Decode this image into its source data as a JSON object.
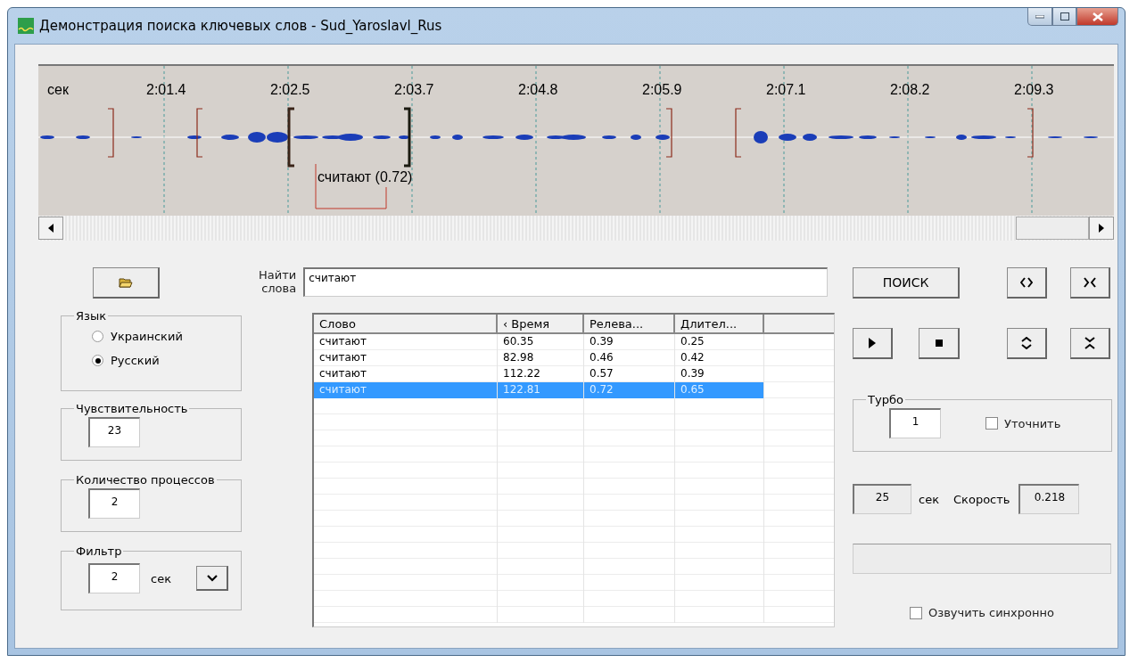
{
  "window": {
    "title": "Демонстрация поиска ключевых слов - Sud_Yaroslavl_Rus"
  },
  "waveform": {
    "unit_label": "сек",
    "time_labels": [
      "2:01.4",
      "2:02.5",
      "2:03.7",
      "2:04.8",
      "2:05.9",
      "2:07.1",
      "2:08.2",
      "2:09.3"
    ],
    "detection_label": "считают (0.72)"
  },
  "search": {
    "label": "Найти слова",
    "value": "считают"
  },
  "language": {
    "title": "Язык",
    "options": [
      {
        "label": "Украинский",
        "selected": false
      },
      {
        "label": "Русский",
        "selected": true
      }
    ]
  },
  "sensitivity": {
    "title": "Чувствительность",
    "value": "23"
  },
  "processes": {
    "title": "Количество процессов",
    "value": "2"
  },
  "filter": {
    "title": "Фильтр",
    "value": "2",
    "unit": "сек"
  },
  "table": {
    "columns": [
      "Слово",
      "‹ Время",
      "Релева...",
      "Длител..."
    ],
    "rows": [
      {
        "cells": [
          "считают",
          "60.35",
          "0.39",
          "0.25"
        ],
        "selected": false
      },
      {
        "cells": [
          "считают",
          "82.98",
          "0.46",
          "0.42"
        ],
        "selected": false
      },
      {
        "cells": [
          "считают",
          "112.22",
          "0.57",
          "0.39"
        ],
        "selected": false
      },
      {
        "cells": [
          "считают",
          "122.81",
          "0.72",
          "0.65"
        ],
        "selected": true
      }
    ]
  },
  "search_button": "ПОИСК",
  "turbo": {
    "title": "Турбо",
    "value": "1",
    "refine": {
      "label": "Уточнить",
      "checked": false
    }
  },
  "duration": {
    "value": "25",
    "unit": "сек"
  },
  "speed": {
    "label": "Скорость",
    "value": "0.218"
  },
  "sync": {
    "label": "Озвучить синхронно",
    "checked": false
  }
}
